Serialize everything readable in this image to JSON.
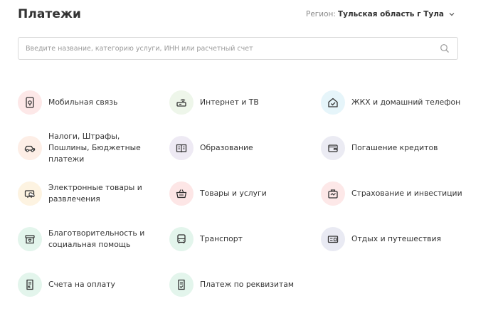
{
  "header": {
    "title": "Платежи",
    "region_label": "Регион:",
    "region_value": "Тульская область г Тула"
  },
  "search": {
    "placeholder": "Введите название, категорию услуги, ИНН или расчетный счет"
  },
  "categories": [
    {
      "label": "Мобильная связь",
      "icon": "mobile-icon",
      "bg": "#fde8e8"
    },
    {
      "label": "Интернет и ТВ",
      "icon": "router-icon",
      "bg": "#eef6ea"
    },
    {
      "label": "ЖКХ и домашний телефон",
      "icon": "house-icon",
      "bg": "#e6f5fa"
    },
    {
      "label": "Налоги, Штрафы, Пошлины, Бюджетные платежи",
      "icon": "car-icon",
      "bg": "#fdeee6"
    },
    {
      "label": "Образование",
      "icon": "book-icon",
      "bg": "#eeeaf4"
    },
    {
      "label": "Погашение кредитов",
      "icon": "wallet-icon",
      "bg": "#ebebf3"
    },
    {
      "label": "Электронные товары и развлечения",
      "icon": "gamepad-icon",
      "bg": "#fdf3e1"
    },
    {
      "label": "Товары и услуги",
      "icon": "basket-icon",
      "bg": "#fde6e6"
    },
    {
      "label": "Страхование и инвестиции",
      "icon": "briefcase-icon",
      "bg": "#fde8e8"
    },
    {
      "label": "Благотворительность и социальная помощь",
      "icon": "charity-box-icon",
      "bg": "#e3f5ec"
    },
    {
      "label": "Транспорт",
      "icon": "bus-icon",
      "bg": "#e3f5ec"
    },
    {
      "label": "Отдых и путешествия",
      "icon": "ticket-icon",
      "bg": "#e9eaf3"
    },
    {
      "label": "Счета на оплату",
      "icon": "invoice-icon",
      "bg": "#e3f5ec"
    },
    {
      "label": "Платеж по реквизитам",
      "icon": "document-check-icon",
      "bg": "#e3f5ec"
    }
  ]
}
